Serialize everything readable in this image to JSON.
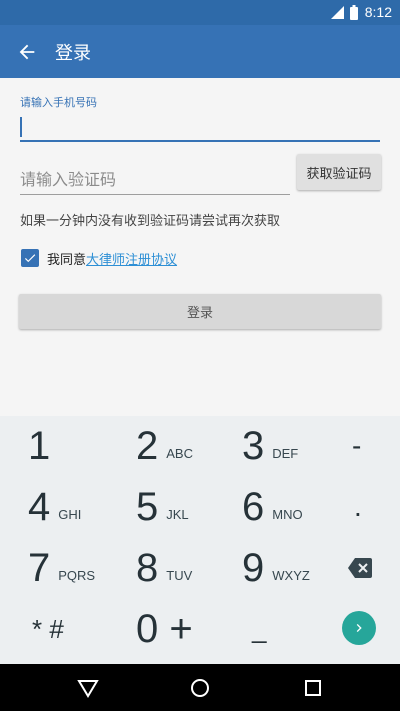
{
  "status_bar": {
    "time": "8:12"
  },
  "app_bar": {
    "title": "登录",
    "back_icon": "arrow-back-icon"
  },
  "form": {
    "phone_label": "请输入手机号码",
    "phone_value": "",
    "code_placeholder": "请输入验证码",
    "get_code_label": "获取验证码",
    "hint": "如果一分钟内没有收到验证码请尝试再次获取",
    "agree_checked": true,
    "agree_text": "我同意",
    "agree_link": "大律师注册协议",
    "login_label": "登录"
  },
  "keyboard": {
    "keys": [
      {
        "num": "1",
        "letters": ""
      },
      {
        "num": "2",
        "letters": "ABC"
      },
      {
        "num": "3",
        "letters": "DEF"
      },
      {
        "num": "-",
        "letters": ""
      },
      {
        "num": "4",
        "letters": "GHI"
      },
      {
        "num": "5",
        "letters": "JKL"
      },
      {
        "num": "6",
        "letters": "MNO"
      },
      {
        "num": ".",
        "letters": ""
      },
      {
        "num": "7",
        "letters": "PQRS"
      },
      {
        "num": "8",
        "letters": "TUV"
      },
      {
        "num": "9",
        "letters": "WXYZ"
      },
      {
        "num": "* #",
        "letters": ""
      },
      {
        "num": "0 +",
        "letters": ""
      },
      {
        "num": "_",
        "letters": ""
      }
    ],
    "backspace_icon": "backspace-icon",
    "go_icon": "chevron-right-icon"
  },
  "colors": {
    "status_bar": "#2e6aa9",
    "app_bar": "#3672b5",
    "link": "#2d8fd5",
    "go_button": "#26a69a",
    "keyboard_bg": "#eceff1"
  }
}
